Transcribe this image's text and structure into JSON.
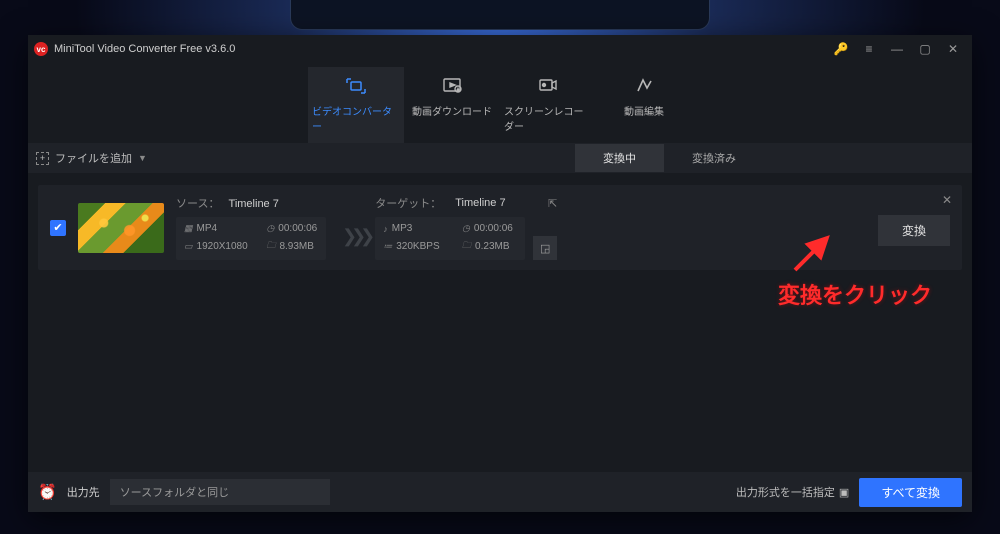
{
  "app": {
    "title": "MiniTool Video Converter Free v3.6.0"
  },
  "topTabs": {
    "converter": "ビデオコンバーター",
    "download": "動画ダウンロード",
    "recorder": "スクリーンレコーダー",
    "editor": "動画編集"
  },
  "secondary": {
    "addFile": "ファイルを追加",
    "tab1": "変換中",
    "tab2": "変換済み"
  },
  "task": {
    "source": {
      "label": "ソース：",
      "name": "Timeline 7",
      "format": "MP4",
      "duration": "00:00:06",
      "resolution": "1920X1080",
      "size": "8.93MB"
    },
    "target": {
      "label": "ターゲット：",
      "name": "Timeline 7",
      "format": "MP3",
      "duration": "00:00:06",
      "bitrate": "320KBPS",
      "size": "0.23MB"
    },
    "convert": "変換"
  },
  "footer": {
    "outputLabel": "出力先",
    "outputValue": "ソースフォルダと同じ",
    "formatAll": "出力形式を一括指定",
    "convertAll": "すべて変換"
  },
  "annotation": {
    "text": "変換をクリック"
  }
}
